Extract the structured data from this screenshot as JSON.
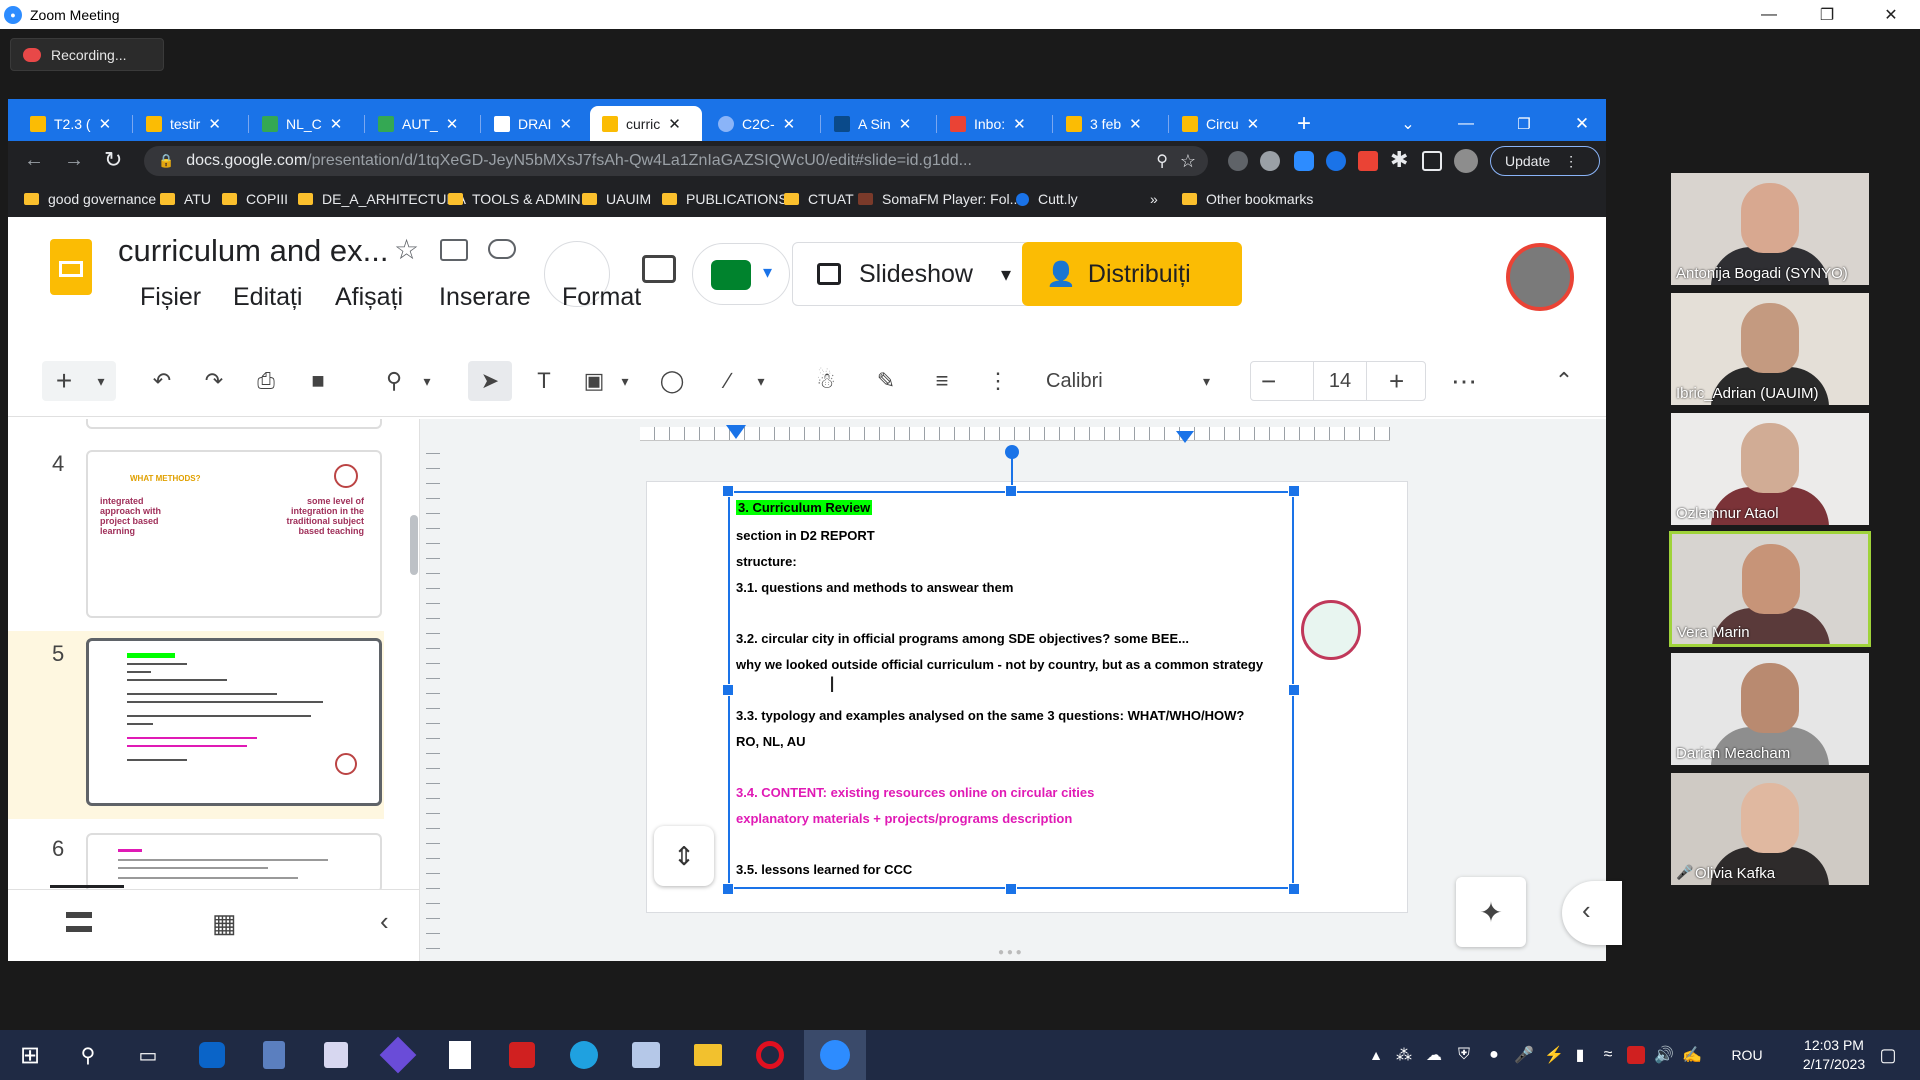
{
  "zoom": {
    "window_title": "Zoom Meeting",
    "recording_label": "Recording...",
    "participants": [
      {
        "name": "Antonija Bogadi (SYNYO)"
      },
      {
        "name": "Ibric_Adrian (UAUIM)"
      },
      {
        "name": "Ozlemnur Ataol"
      },
      {
        "name": "Vera Marin"
      },
      {
        "name": "Darian Meacham"
      },
      {
        "name": "Olivia Kafka"
      }
    ]
  },
  "browser": {
    "tabs": [
      {
        "label": "T2.3 ("
      },
      {
        "label": "testir"
      },
      {
        "label": "NL_C"
      },
      {
        "label": "AUT_"
      },
      {
        "label": "DRAI"
      },
      {
        "label": "curric"
      },
      {
        "label": "C2C-"
      },
      {
        "label": "A Sin"
      },
      {
        "label": "Inbo:"
      },
      {
        "label": "3 feb"
      },
      {
        "label": "Circu"
      }
    ],
    "url_domain": "docs.google.com",
    "url_path": "/presentation/d/1tqXeGD-JeyN5bMXsJ7fsAh-Qw4La1ZnIaGAZSIQWcU0/edit#slide=id.g1dd...",
    "update_label": "Update",
    "bookmarks": [
      {
        "label": "good governance"
      },
      {
        "label": "ATU"
      },
      {
        "label": "COPIII"
      },
      {
        "label": "DE_A_ARHITECTURA"
      },
      {
        "label": "TOOLS & ADMIN"
      },
      {
        "label": "UAUIM"
      },
      {
        "label": "PUBLICATIONS"
      },
      {
        "label": "CTUAT"
      },
      {
        "label": "SomaFM Player: Fol..."
      },
      {
        "label": "Cutt.ly"
      }
    ],
    "bookmarks_overflow": "»",
    "other_bookmarks": "Other bookmarks"
  },
  "slides": {
    "doc_title": "curriculum and ex...",
    "menu": [
      "Fișier",
      "Editați",
      "Afișați",
      "Inserare",
      "Format"
    ],
    "slideshow_label": "Slideshow",
    "share_label": "Distribuiți",
    "font_name": "Calibri",
    "font_size": "14",
    "thumbnails": [
      {
        "number": "4",
        "heading": "WHAT METHODS?",
        "left": "integrated approach with project based learning",
        "right": "some level of integration in the traditional subject based teaching"
      },
      {
        "number": "5"
      },
      {
        "number": "6"
      }
    ],
    "slide_lines": [
      {
        "text": "3.       Curriculum Review",
        "highlight": true
      },
      {
        "text": "section in D2 REPORT"
      },
      {
        "text": "structure:"
      },
      {
        "text": "3.1. questions and methods to answear them"
      },
      {
        "text": ""
      },
      {
        "text": "3.2. circular city in official programs among SDE objectives? some BEE..."
      },
      {
        "text": "why we looked outside official curriculum - not by country, but as a common strategy"
      },
      {
        "text": ""
      },
      {
        "text": "3.3. typology and examples analysed on the same 3 questions: WHAT/WHO/HOW?"
      },
      {
        "text": "RO, NL, AU"
      },
      {
        "text": ""
      },
      {
        "text": "3.4. CONTENT: existing resources online on circular cities",
        "magenta": true
      },
      {
        "text": "explanatory materials + projects/programs description",
        "magenta": true
      },
      {
        "text": ""
      },
      {
        "text": "3.5. lessons learned for CCC"
      }
    ]
  },
  "taskbar": {
    "language": "ROU",
    "time": "12:03 PM",
    "date": "2/17/2023"
  },
  "colors": {
    "chrome_blue": "#1a73e8",
    "share_yellow": "#fbbc04",
    "highlight_green": "#00ff00",
    "magenta": "#e01ab5"
  }
}
